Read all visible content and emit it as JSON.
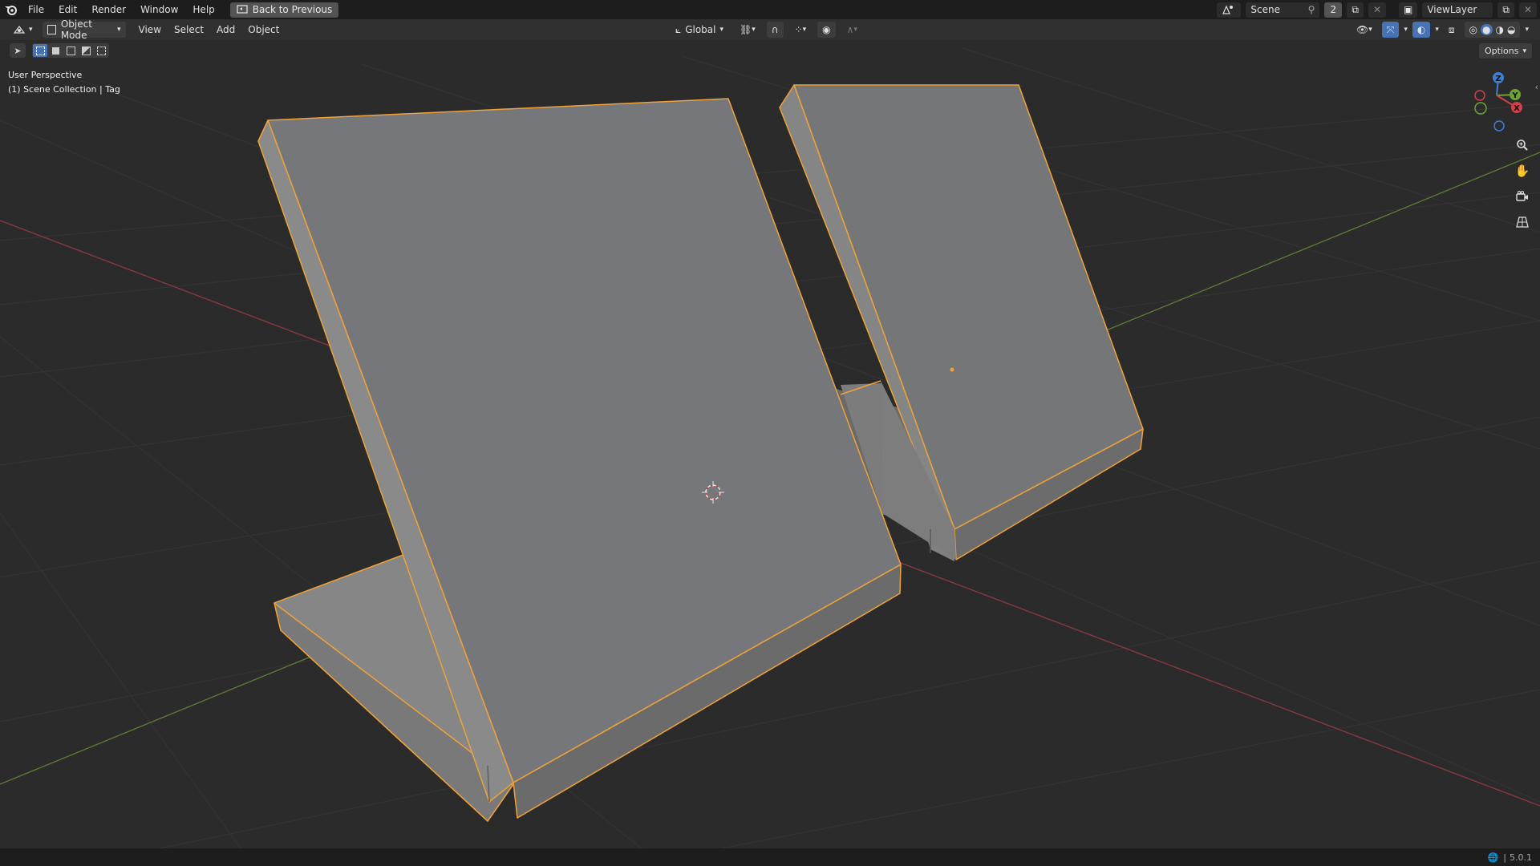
{
  "topbar": {
    "menu": [
      "File",
      "Edit",
      "Render",
      "Window",
      "Help"
    ],
    "back_label": "Back to Previous",
    "scene_name": "Scene",
    "scene_users": "2",
    "view_layer": "ViewLayer"
  },
  "header": {
    "mode": "Object Mode",
    "menu": [
      "View",
      "Select",
      "Add",
      "Object"
    ],
    "transform_orientation": "Global"
  },
  "viewport": {
    "perspective_label": "User Perspective",
    "collection_label": "(1) Scene Collection | Tag",
    "options_label": "Options",
    "gizmo": {
      "x": "X",
      "y": "Y",
      "z": "Z"
    }
  },
  "status": {
    "version": "5.0.1"
  },
  "colors": {
    "accent_blue": "#4772b3",
    "selection_outline": "#f0a23a",
    "axis_x": "#d0414b",
    "axis_y": "#6fa33a",
    "axis_z": "#3b7fd6"
  }
}
